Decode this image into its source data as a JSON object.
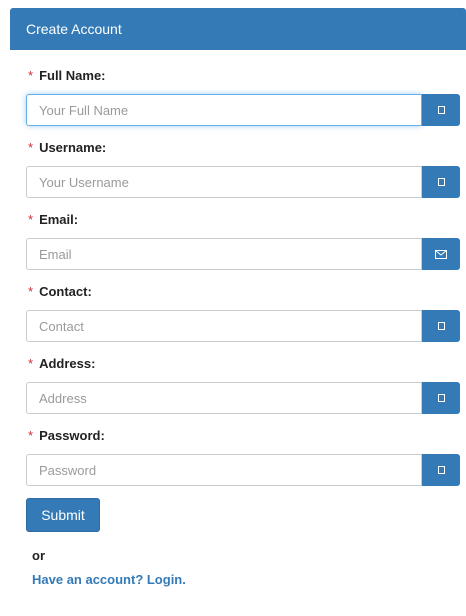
{
  "form": {
    "title": "Create Account",
    "required_marker": "*",
    "fields": [
      {
        "label": "Full Name:",
        "placeholder": "Your Full Name",
        "value": "",
        "icon": "square-icon"
      },
      {
        "label": "Username:",
        "placeholder": "Your Username",
        "value": "",
        "icon": "square-icon"
      },
      {
        "label": "Email:",
        "placeholder": "Email",
        "value": "",
        "icon": "envelope-icon"
      },
      {
        "label": "Contact:",
        "placeholder": "Contact",
        "value": "",
        "icon": "square-icon"
      },
      {
        "label": "Address:",
        "placeholder": "Address",
        "value": "",
        "icon": "square-icon"
      },
      {
        "label": "Password:",
        "placeholder": "Password",
        "value": "",
        "icon": "square-icon"
      }
    ],
    "submit_label": "Submit",
    "or_text": "or",
    "login_link": "Have an account? Login."
  },
  "colors": {
    "primary": "#337ab7",
    "required": "#c9302c",
    "focus_border": "#66afe9"
  }
}
